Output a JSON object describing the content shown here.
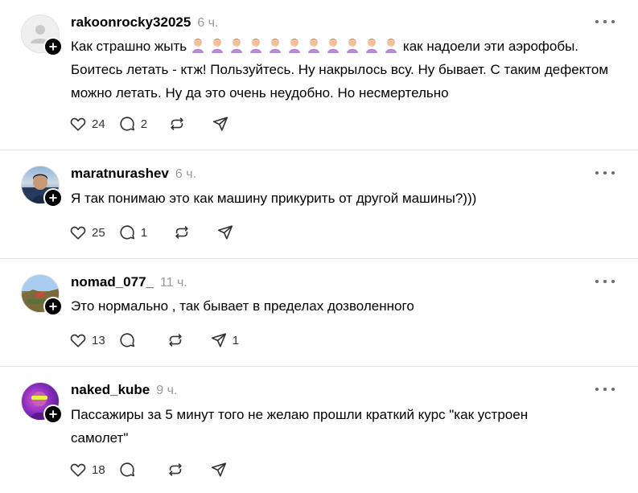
{
  "posts": [
    {
      "username": "rakoonrocky32025",
      "time": "6 ч.",
      "text_lead": "Как страшно жыть",
      "text_rest": "как надоели эти аэрофобы. Боитесь летать - ктж! Пользуйтесь. Ну накрылось всу. Ну бывает. С таким дефектом можно летать. Ну да это очень неудобно. Но несмертельно",
      "emoji_icon": "woman-facepalming-icon",
      "emoji_count": 11,
      "avatar": "default-avatar-icon",
      "likes": "24",
      "replies": "2",
      "reposts": "",
      "shares": ""
    },
    {
      "username": "maratnurashev",
      "time": "6 ч.",
      "text": "Я так понимаю это как машину прикурить от другой машины?)))",
      "avatar": "user-photo-avatar",
      "likes": "25",
      "replies": "1",
      "reposts": "",
      "shares": ""
    },
    {
      "username": "nomad_077_",
      "time": "11 ч.",
      "text": "Это нормально , так бывает в пределах дозволенного",
      "avatar": "landscape-photo-avatar",
      "likes": "13",
      "replies": "",
      "reposts": "",
      "shares": "1"
    },
    {
      "username": "naked_kube",
      "time": "9 ч.",
      "text": "Пассажиры за 5 минут того не желаю прошли краткий курс \"как устроен самолет\"",
      "avatar": "purple-photo-avatar",
      "likes": "18",
      "replies": "",
      "reposts": "",
      "shares": ""
    }
  ],
  "icons": {
    "like": "heart-icon",
    "reply": "speech-bubble-icon",
    "repost": "repost-arrows-icon",
    "share": "send-plane-icon",
    "more": "more-dots-icon",
    "follow": "plus-icon"
  },
  "colors": {
    "text": "#000000",
    "muted": "#999999",
    "divider": "#e6e6e6",
    "emoji_purple": "#b48ad6",
    "emoji_skin": "#f4c7a1",
    "emoji_hair": "#5a3a26"
  }
}
